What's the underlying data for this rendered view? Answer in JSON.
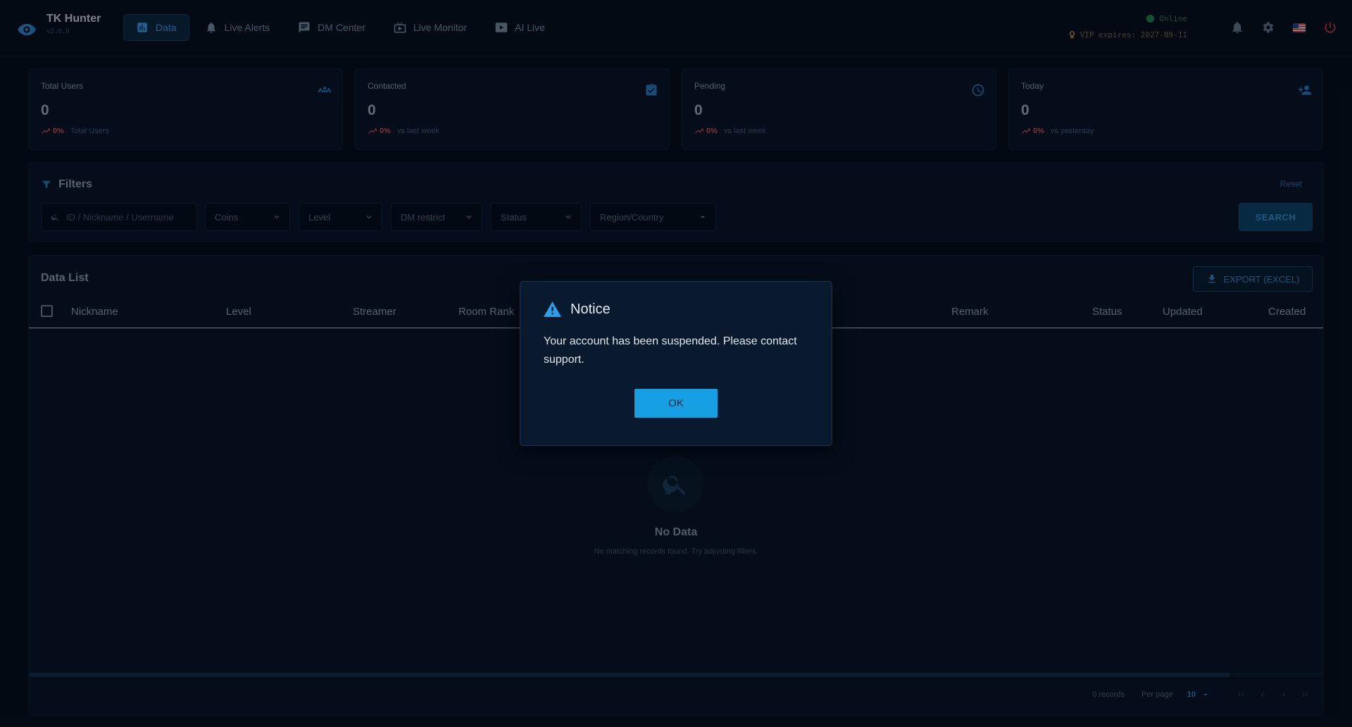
{
  "app": {
    "title": "TK Hunter",
    "version": "v2.0.0"
  },
  "nav": [
    {
      "label": "Data",
      "icon": "chart-icon",
      "active": true
    },
    {
      "label": "Live Alerts",
      "icon": "bell-icon"
    },
    {
      "label": "DM Center",
      "icon": "message-icon"
    },
    {
      "label": "Live Monitor",
      "icon": "tv-icon"
    },
    {
      "label": "AI Live",
      "icon": "play-icon"
    }
  ],
  "status": {
    "online": "Online",
    "vip": "VIP expires: 2027-09-11"
  },
  "stats": [
    {
      "label": "Total Users",
      "value": "0",
      "pct": "0%",
      "sub": "Total Users",
      "icon": "group-icon"
    },
    {
      "label": "Contacted",
      "value": "0",
      "pct": "0%",
      "sub": "vs last week",
      "icon": "clipboard-check-icon"
    },
    {
      "label": "Pending",
      "value": "0",
      "pct": "0%",
      "sub": "vs last week",
      "icon": "clock-icon"
    },
    {
      "label": "Today",
      "value": "0",
      "pct": "0%",
      "sub": "vs yesterday",
      "icon": "person-add-icon"
    }
  ],
  "filters": {
    "title": "Filters",
    "reset": "Reset",
    "search_placeholder": "ID / Nickname / Username",
    "coins": "Coins",
    "level": "Level",
    "dm_restrict": "DM restrict",
    "status": "Status",
    "region": "Region/Country",
    "search_button": "SEARCH"
  },
  "datalist": {
    "title": "Data List",
    "export": "EXPORT (EXCEL)",
    "columns": [
      "Nickname",
      "Level",
      "Streamer",
      "Room Rank",
      "Remark",
      "Status",
      "Updated",
      "Created"
    ],
    "empty_title": "No Data",
    "empty_sub": "No matching records found. Try adjusting filters.",
    "records": "0 records",
    "per_page_label": "Per page",
    "per_page_value": "10"
  },
  "modal": {
    "title": "Notice",
    "message": "Your account has been suspended. Please contact support.",
    "ok": "OK"
  },
  "colors": {
    "accent": "#169fe3",
    "danger": "#c24452",
    "background": "#040c17",
    "online": "#1e7a4e"
  }
}
